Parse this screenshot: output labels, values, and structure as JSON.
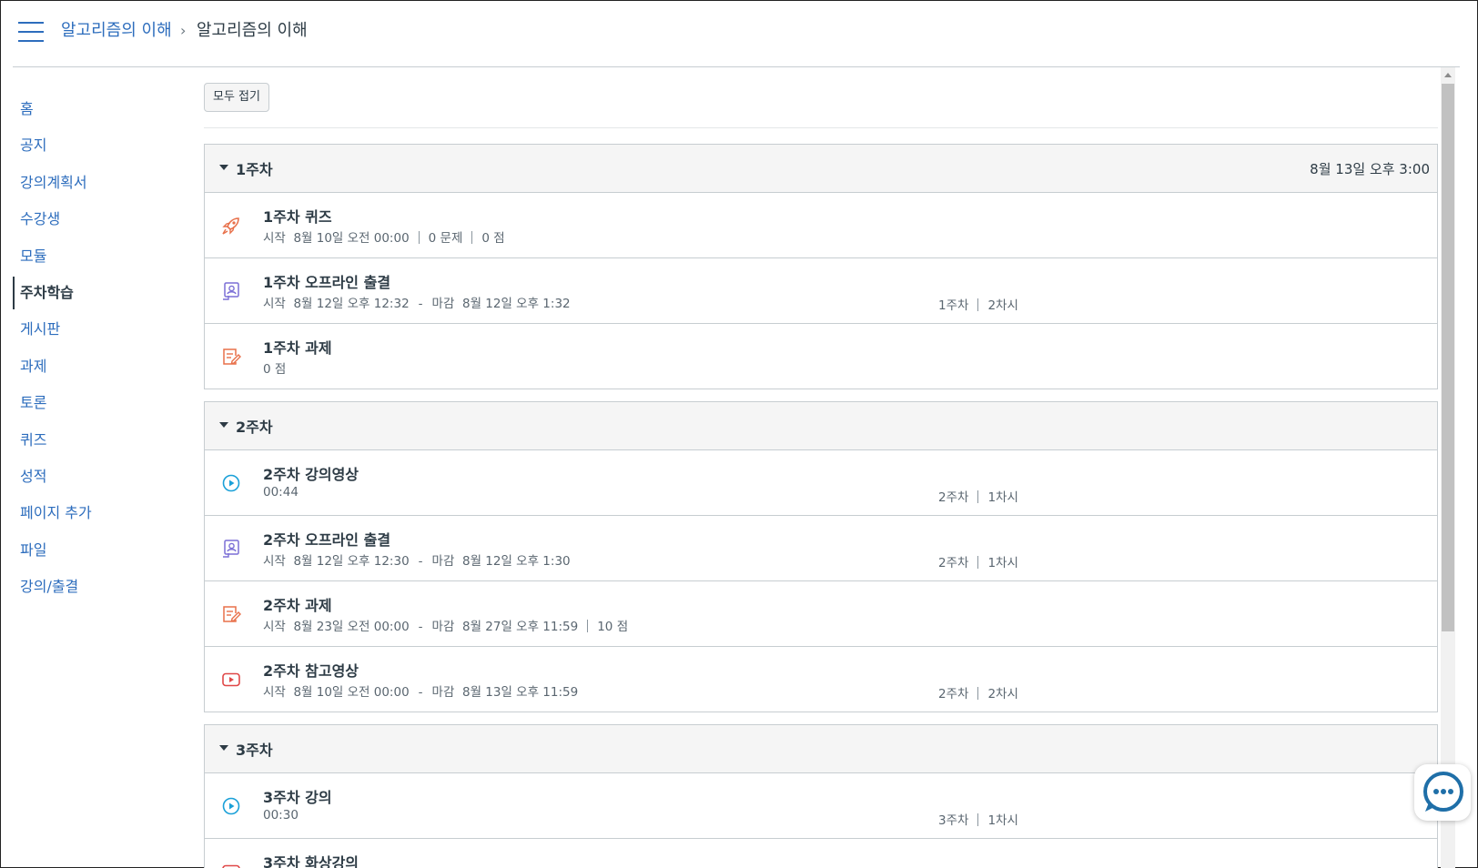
{
  "breadcrumb": {
    "course_link": "알고리즘의 이해",
    "separator": "›",
    "current": "알고리즘의 이해"
  },
  "sidebar": {
    "items": [
      {
        "label": "홈"
      },
      {
        "label": "공지"
      },
      {
        "label": "강의계획서"
      },
      {
        "label": "수강생"
      },
      {
        "label": "모듈"
      },
      {
        "label": "주차학습",
        "active": true
      },
      {
        "label": "게시판"
      },
      {
        "label": "과제"
      },
      {
        "label": "토론"
      },
      {
        "label": "퀴즈"
      },
      {
        "label": "성적"
      },
      {
        "label": "페이지 추가"
      },
      {
        "label": "파일"
      },
      {
        "label": "강의/출결"
      }
    ]
  },
  "main": {
    "collapse_all_label": "모두 접기",
    "modules": [
      {
        "title": "1주차",
        "date": "8월 13일 오후 3:00",
        "items": [
          {
            "icon": "rocket-quiz-icon",
            "title": "1주차 퀴즈",
            "start_label": "시작",
            "start": "8월 10일 오전 00:00",
            "questions": "0 문제",
            "points": "0 점"
          },
          {
            "icon": "offline-attendance-icon",
            "title": "1주차 오프라인 출결",
            "start_label": "시작",
            "start": "8월 12일 오후 12:32",
            "due_label": "마감",
            "due": "8월 12일 오후 1:32",
            "week": "1주차",
            "session": "2차시"
          },
          {
            "icon": "assignment-icon",
            "title": "1주차 과제",
            "points": "0 점"
          }
        ]
      },
      {
        "title": "2주차",
        "date": "",
        "items": [
          {
            "icon": "video-play-icon",
            "title": "2주차 강의영상",
            "duration": "00:44",
            "week": "2주차",
            "session": "1차시"
          },
          {
            "icon": "offline-attendance-icon",
            "title": "2주차 오프라인 출결",
            "start_label": "시작",
            "start": "8월 12일 오후 12:30",
            "due_label": "마감",
            "due": "8월 12일 오후 1:30",
            "week": "2주차",
            "session": "1차시"
          },
          {
            "icon": "assignment-icon",
            "title": "2주차 과제",
            "start_label": "시작",
            "start": "8월 23일 오전 00:00",
            "due_label": "마감",
            "due": "8월 27일 오후 11:59",
            "points": "10 점"
          },
          {
            "icon": "youtube-icon",
            "title": "2주차 참고영상",
            "start_label": "시작",
            "start": "8월 10일 오전 00:00",
            "due_label": "마감",
            "due": "8월 13일 오후 11:59",
            "week": "2주차",
            "session": "2차시"
          }
        ]
      },
      {
        "title": "3주차",
        "date": "",
        "items": [
          {
            "icon": "video-play-icon",
            "title": "3주차 강의",
            "duration": "00:30",
            "week": "3주차",
            "session": "1차시"
          },
          {
            "icon": "youtube-icon",
            "title": "3주차 화상강의"
          }
        ]
      }
    ]
  },
  "colors": {
    "link": "#2d6dbd",
    "text": "#2d3b45",
    "quiz_icon": "#e8704a",
    "attendance_icon": "#7b6fd6",
    "assignment_icon": "#e8704a",
    "video_icon": "#1aa0d8",
    "youtube_icon": "#e04848",
    "chat_icon": "#1f6fa8"
  }
}
